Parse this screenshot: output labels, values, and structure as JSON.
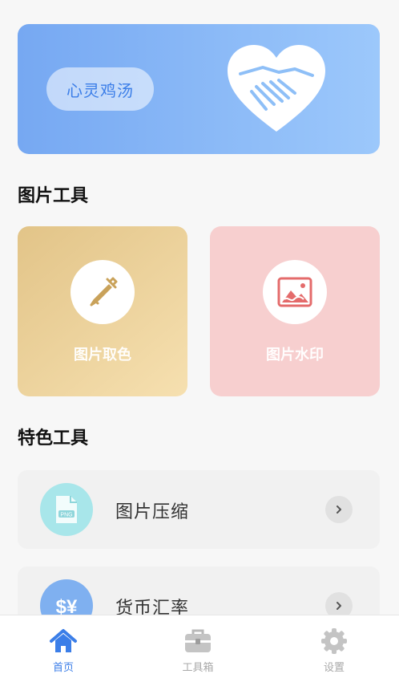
{
  "banner": {
    "pill_label": "心灵鸡汤"
  },
  "sections": {
    "image_tools_title": "图片工具",
    "feature_tools_title": "特色工具"
  },
  "image_tools": [
    {
      "label": "图片取色",
      "icon": "eyedropper-icon"
    },
    {
      "label": "图片水印",
      "icon": "image-icon"
    }
  ],
  "feature_tools": [
    {
      "label": "图片压缩",
      "icon": "png-file-icon"
    },
    {
      "label": "货币汇率",
      "icon": "currency-icon"
    }
  ],
  "tabbar": {
    "items": [
      {
        "label": "首页",
        "icon": "home-icon",
        "active": true
      },
      {
        "label": "工具箱",
        "icon": "toolbox-icon",
        "active": false
      },
      {
        "label": "设置",
        "icon": "gear-icon",
        "active": false
      }
    ]
  },
  "colors": {
    "accent": "#3b7ee8",
    "banner_start": "#76a8f2",
    "banner_end": "#9cc8fb",
    "card_gold": "#e2c488",
    "card_pink": "#f7cfcf",
    "compress_icon_bg": "#a8e6ea",
    "currency_icon_bg": "#7fb0f0"
  }
}
